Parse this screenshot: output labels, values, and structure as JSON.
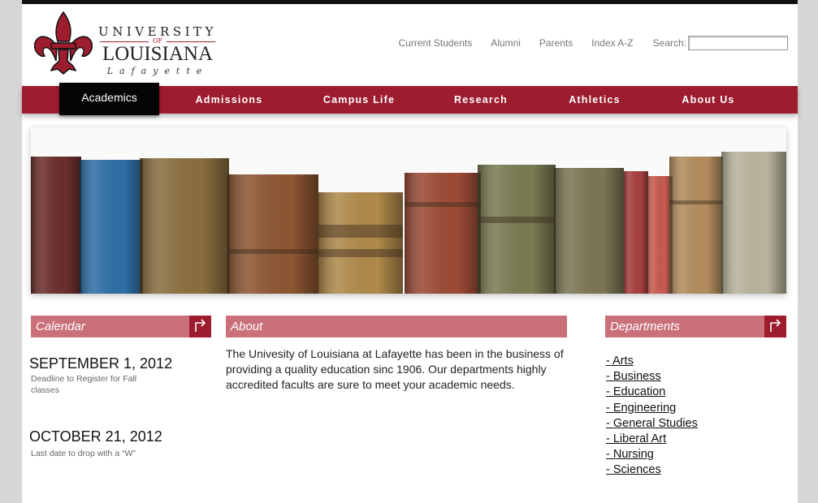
{
  "logo": {
    "line1": "UNIVERSITY",
    "line2": "OF",
    "line3": "LOUISIANA",
    "line4": "Lafayette",
    "mark": "fleur-de-lis-icon"
  },
  "top_links": [
    "Current Students",
    "Alumni",
    "Parents",
    "Index A-Z"
  ],
  "search": {
    "label": "Search:",
    "value": ""
  },
  "nav": {
    "items": [
      {
        "label": "Academics",
        "active": true
      },
      {
        "label": "Admissions",
        "active": false
      },
      {
        "label": "Campus Life",
        "active": false
      },
      {
        "label": "Research",
        "active": false
      },
      {
        "label": "Athletics",
        "active": false
      },
      {
        "label": "About Us",
        "active": false
      }
    ]
  },
  "banner": {
    "subject": "row of antique books"
  },
  "calendar": {
    "title": "Calendar",
    "events": [
      {
        "date": "SEPTEMBER 1, 2012",
        "desc": "Deadline to Register for Fall classes"
      },
      {
        "date": "OCTOBER 21, 2012",
        "desc": "Last date to drop with a “W”"
      }
    ]
  },
  "about": {
    "title": "About",
    "text": "The Univesity of Louisiana at Lafayette has been in the business of providing a quality education sinc 1906. Our departments highly accredited facults are sure to meet your academic needs."
  },
  "departments": {
    "title": "Departments",
    "items": [
      "- Arts",
      "- Business",
      "- Education",
      "- Engineering",
      "- General Studies",
      "- Liberal Art",
      "- Nursing",
      "- Sciences"
    ]
  },
  "colors": {
    "brand": "#9d1c2e",
    "panel": "#c9707a",
    "nav_active": "#050505"
  }
}
